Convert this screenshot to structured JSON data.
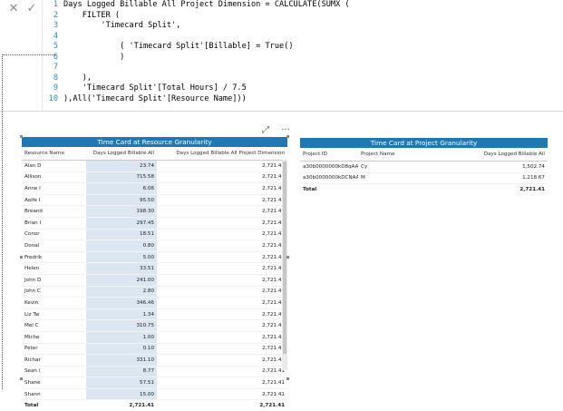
{
  "formula_bar": {
    "cancel_icon": "close-icon",
    "commit_icon": "check-icon",
    "line_numbers": [
      "1",
      "2",
      "3",
      "4",
      "5",
      "6",
      "7",
      "8",
      "9",
      "10"
    ],
    "lines": [
      "Days Logged Billable All Project Dimension = CALCULATE(SUMX (",
      "    FILTER (",
      "        'Timecard Split',",
      "",
      "            ( 'Timecard Split'[Billable] = True()",
      "            )",
      "",
      "    ),",
      "    'Timecard Split'[Total Hours] / 7.5",
      "),All('Timecard Split'[Resource Name]))"
    ]
  },
  "visual_header": {
    "focus_icon": "focus-mode-icon",
    "more_icon": "more-options-icon",
    "focus_glyph": "⤢",
    "more_glyph": "···"
  },
  "resource_table": {
    "title": "Time Card at Resource Granularity",
    "columns": [
      "Resource Name",
      "Days Logged Billable All",
      "Days Logged Billable All Project Dimension"
    ],
    "rows": [
      [
        "Alan D",
        "23.74",
        "2,721.41"
      ],
      [
        "Allison",
        "715.58",
        "2,721.41"
      ],
      [
        "Anne I",
        "6.06",
        "2,721.41"
      ],
      [
        "Aoife I",
        "95.50",
        "2,721.41"
      ],
      [
        "Breand",
        "198.30",
        "2,721.41"
      ],
      [
        "Brian I",
        "297.45",
        "2,721.41"
      ],
      [
        "Conor",
        "18.51",
        "2,721.41"
      ],
      [
        "Donal",
        "0.80",
        "2,721.41"
      ],
      [
        "Fredrik",
        "5.00",
        "2,721.41"
      ],
      [
        "Helen",
        "33.51",
        "2,721.41"
      ],
      [
        "John D",
        "241.00",
        "2,721.41"
      ],
      [
        "John C",
        "2.80",
        "2,721.41"
      ],
      [
        "Kevin",
        "346.46",
        "2,721.41"
      ],
      [
        "Liz Tw",
        "1.34",
        "2,721.41"
      ],
      [
        "Mel C",
        "310.75",
        "2,721.41"
      ],
      [
        "Miche",
        "1.00",
        "2,721.41"
      ],
      [
        "Peter",
        "0.10",
        "2,721.41"
      ],
      [
        "Richar",
        "331.10",
        "2,721.41"
      ],
      [
        "Sean (",
        "8.77",
        "2,721.41"
      ],
      [
        "Shane",
        "57.51",
        "2,721.41"
      ],
      [
        "Shann",
        "15.00",
        "2,721.41"
      ]
    ],
    "total": [
      "Total",
      "2,721.41",
      "2,721.41"
    ]
  },
  "project_table": {
    "title": "Time Card at Project Granularity",
    "columns": [
      "Project ID",
      "Project Name",
      "Days Logged Billable All"
    ],
    "rows": [
      [
        "a30b0000000kD8qAAM",
        "Cy",
        "1,502.74"
      ],
      [
        "a30b0000000kDCNAA2",
        "M",
        "1,218.67"
      ]
    ],
    "total": [
      "Total",
      "",
      "2,721.41"
    ]
  }
}
